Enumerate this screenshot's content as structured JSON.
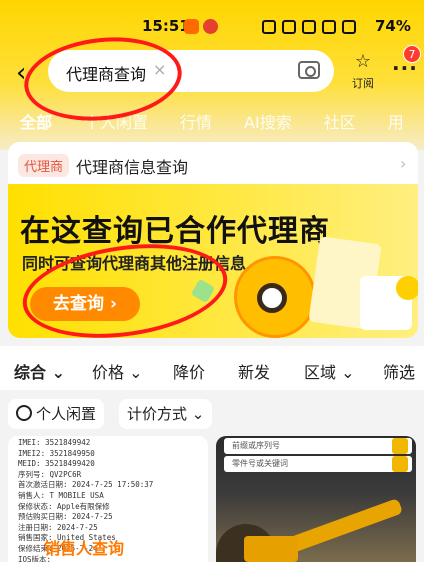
{
  "status_bar": {
    "time": "15:51",
    "battery": "74%"
  },
  "header": {
    "back_icon": "chevron-left-icon",
    "search": {
      "value": "代理商查询",
      "clear_label": "×",
      "camera_icon": "camera-icon"
    },
    "subscribe_label": "订阅",
    "more_badge": "7",
    "tabs": [
      {
        "label": "全部"
      },
      {
        "label": "个人闲置"
      },
      {
        "label": "行情"
      },
      {
        "label": "AI搜索"
      },
      {
        "label": "社区"
      },
      {
        "label": "用"
      }
    ]
  },
  "card": {
    "tag": "代理商",
    "title": "代理商信息查询",
    "banner": {
      "headline": "在这查询已合作代理商",
      "subline": "同时可查询代理商其他注册信息",
      "button": "去查询 ›"
    }
  },
  "filters": {
    "items": [
      "综合 ⌄",
      "价格 ⌄",
      "降价",
      "新发",
      "区域 ⌄",
      "筛选"
    ]
  },
  "chips": [
    {
      "label": "个人闲置"
    },
    {
      "label": "计价方式 ⌄"
    }
  ],
  "tiles": {
    "left": {
      "lines": "IMEI: 3521849942\nIMEI2: 3521849950\nMEID: 35218499420\n序列号: QV2PC6R\n首次激活日期: 2024-7-25 17:50:37\n销售人: T MOBILE USA\n保修状态: Apple有限保修\n预估购买日期: 2024-7-25\n注册日期: 2024-7-25\n销售国家: United States\n保修结束: 2025-7-24\nIOS版本: \n保修和服务覆盖范围: 有效",
      "overlay": "销售人查询"
    },
    "right": {
      "input1": "前缀或序列号",
      "input2": "零件号或关键词"
    }
  }
}
